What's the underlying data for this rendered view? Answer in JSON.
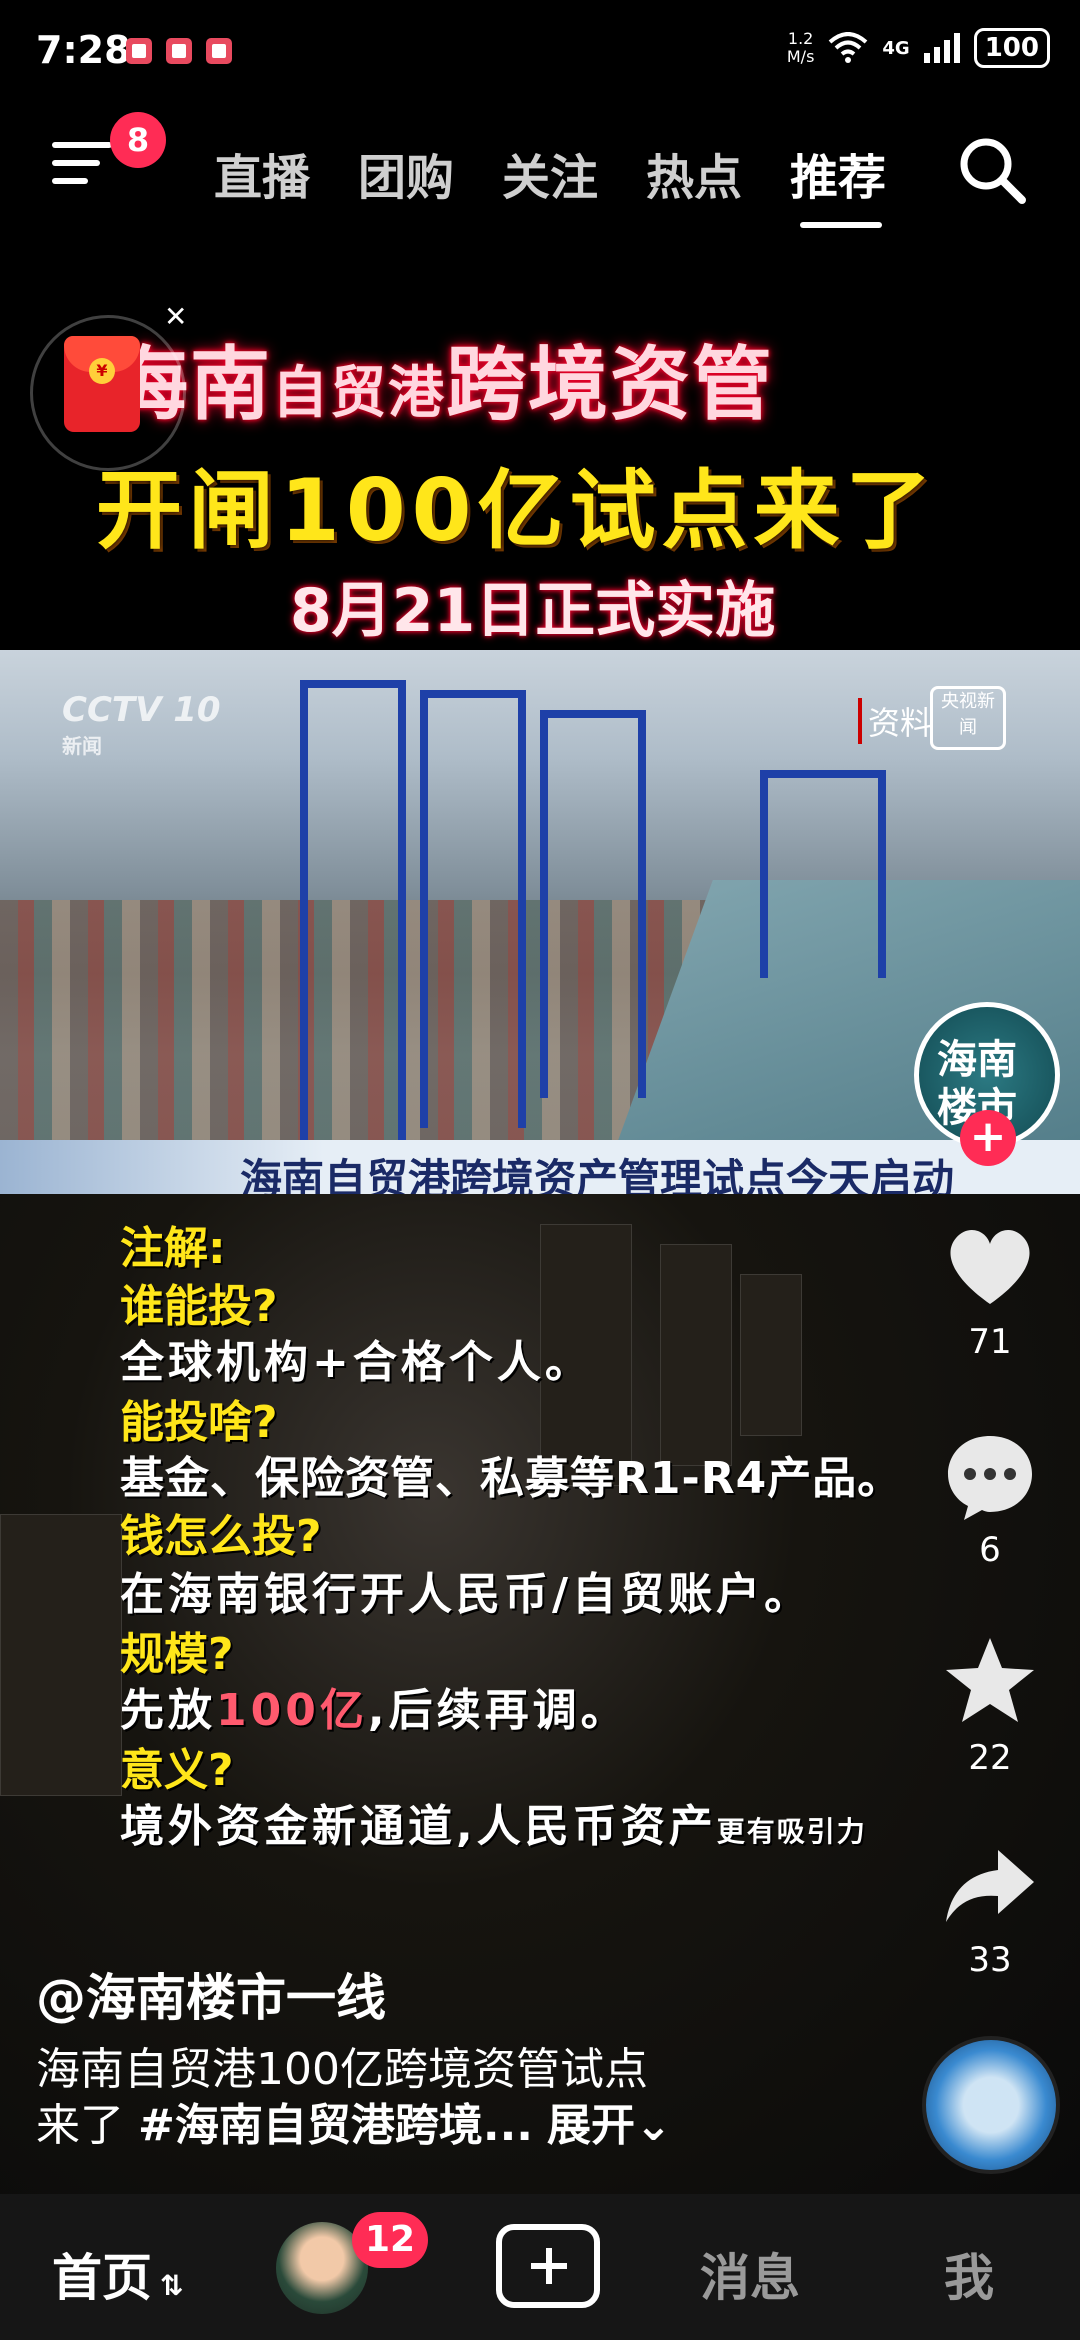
{
  "status_bar": {
    "time": "7:28",
    "net_speed": "1.2\nM/s",
    "network": "4G",
    "battery": "100"
  },
  "top_nav": {
    "menu_badge": "8",
    "tabs": [
      "直播",
      "团购",
      "关注",
      "热点",
      "推荐"
    ],
    "active_tab": "推荐"
  },
  "video": {
    "title_line1_a": "海南",
    "title_line1_b": "自贸港",
    "title_line1_c": "跨境资管",
    "title_line2": "开闸100亿试点来了",
    "title_line3": "8月21日正式实施",
    "cctv_logo": "CCTV 10",
    "cctv_sub": "新闻",
    "source_tag": "资料",
    "source_logo": "央视新闻",
    "caption": "海南自贸港跨境资产管理试点今天启动",
    "notes": {
      "header": "注解:",
      "q1": "谁能投?",
      "a1": "全球机构+合格个人。",
      "q2": "能投啥?",
      "a2": "基金、保险资管、私募等R1-R4产品。",
      "q3": "钱怎么投?",
      "a3": "在海南银行开人民币/自贸账户。",
      "q4": "规模?",
      "a4_pre": "先放",
      "a4_hl": "100亿",
      "a4_post": ",后续再调。",
      "q5": "意义?",
      "a5": "境外资金新通道,人民币资产",
      "a5_small": "更有吸引力"
    }
  },
  "right_rail": {
    "avatar_text_1": "海南",
    "avatar_text_2": "楼市",
    "likes": "71",
    "comments": "6",
    "favorites": "22",
    "shares": "33"
  },
  "post": {
    "author": "@海南楼市一线",
    "desc_line1": "海南自贸港100亿跨境资管试点",
    "desc_line2_pre": "来了 ",
    "desc_tag": "#海南自贸港跨境...",
    "expand": "展开"
  },
  "bottom_nav": {
    "home": "首页",
    "friends_badge": "12",
    "messages": "消息",
    "me": "我"
  }
}
